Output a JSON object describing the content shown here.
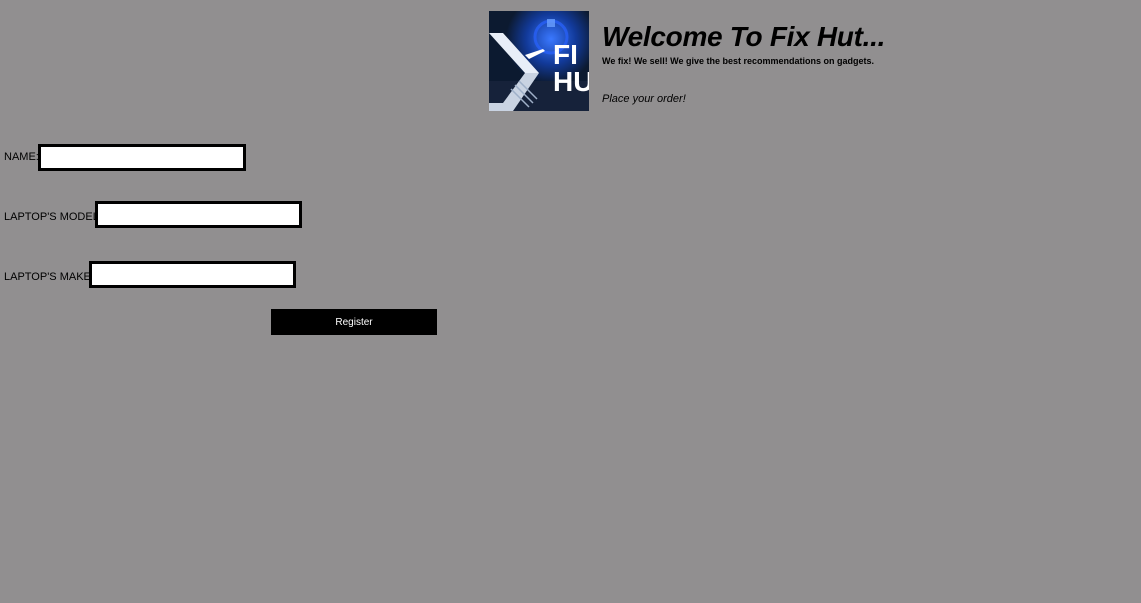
{
  "header": {
    "logo_text": "FIX HUT",
    "title": "Welcome To Fix Hut...",
    "subtitle": "We fix! We sell! We give the best recommendations on gadgets.",
    "cta": "Place your order!"
  },
  "form": {
    "name_label": "NAME:",
    "name_value": "",
    "model_label": "LAPTOP'S MODEL:",
    "model_value": "",
    "make_label": "LAPTOP'S MAKE:",
    "make_value": "",
    "register_label": "Register"
  },
  "colors": {
    "background": "#918f90",
    "button": "#000000",
    "button_text": "#ffffff",
    "logo_glow": "#1e4fd8"
  }
}
